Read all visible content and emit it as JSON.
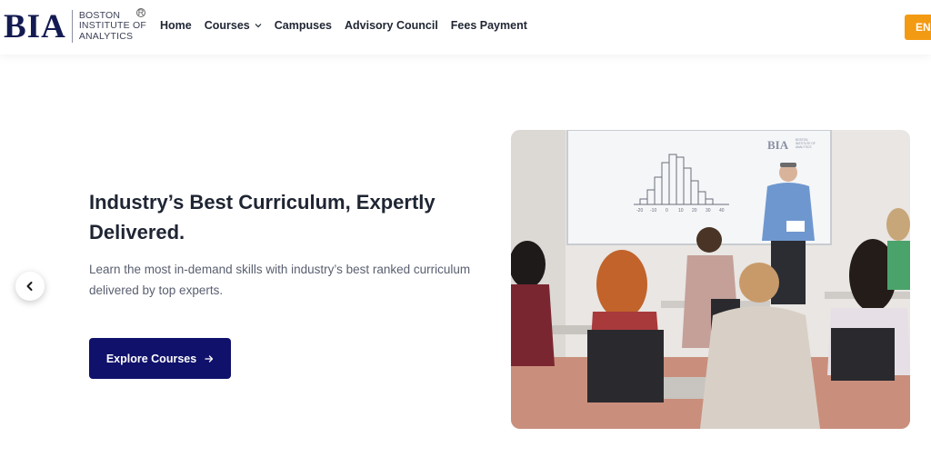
{
  "header": {
    "logo": {
      "mark": "BIA",
      "lines": [
        "BOSTON",
        "INSTITUTE OF",
        "ANALYTICS"
      ],
      "reg": "R"
    },
    "nav": [
      {
        "label": "Home"
      },
      {
        "label": "Courses",
        "has_dropdown": true
      },
      {
        "label": "Campuses"
      },
      {
        "label": "Advisory Council"
      },
      {
        "label": "Fees Payment"
      }
    ],
    "cta_label": "EN"
  },
  "hero": {
    "title_line1": "Industry’s Best Curriculum, Expertly",
    "title_line2": "Delivered.",
    "subtitle_line1": "Learn the most in-demand skills with industry’s best ranked curriculum",
    "subtitle_line2": "delivered by top experts.",
    "button_label": "Explore Courses",
    "image": {
      "whiteboard_logo": "BIA",
      "whiteboard_logo_text": [
        "BOSTON",
        "INSTITUTE OF",
        "ANALYTICS"
      ],
      "chart_ticks": [
        "-20",
        "-10",
        "0",
        "10",
        "20",
        "30",
        "40"
      ]
    }
  },
  "colors": {
    "brand_navy": "#10116b",
    "logo_navy": "#141b52",
    "accent_orange": "#f39a13",
    "text_dark": "#1f2533",
    "text_muted": "#5a5f70"
  },
  "icons": {
    "prev": "chevron-left-icon",
    "explore_arrow": "arrow-right-icon",
    "dropdown": "chevron-down-icon"
  }
}
